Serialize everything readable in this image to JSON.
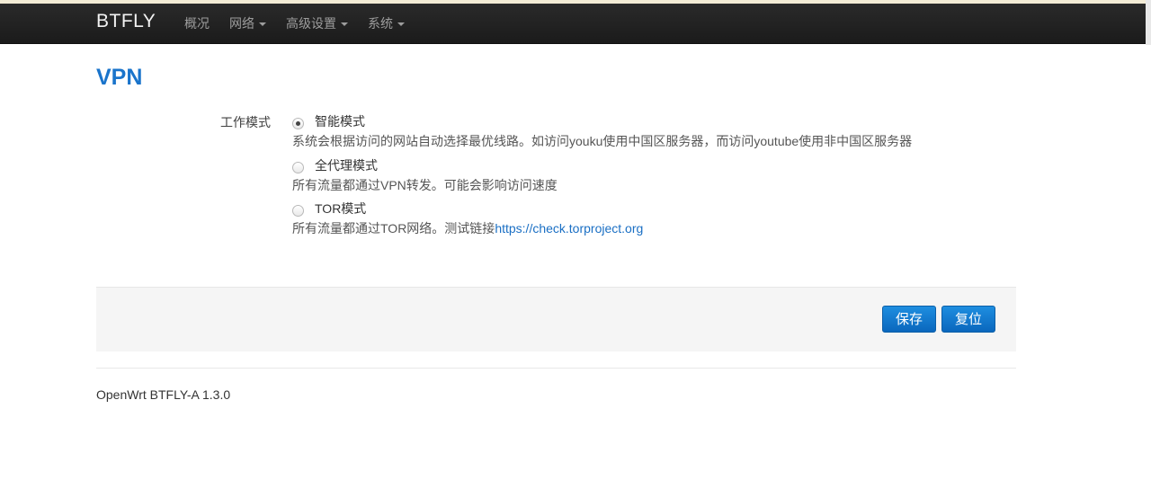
{
  "navbar": {
    "brand": "BTFLY",
    "items": [
      {
        "label": "概况",
        "dropdown": false
      },
      {
        "label": "网络",
        "dropdown": true
      },
      {
        "label": "高级设置",
        "dropdown": true
      },
      {
        "label": "系统",
        "dropdown": true
      }
    ]
  },
  "page": {
    "title": "VPN",
    "field_label": "工作模式",
    "options": [
      {
        "label": "智能模式",
        "checked": true,
        "description": "系统会根据访问的网站自动选择最优线路。如访问youku使用中国区服务器，而访问youtube使用非中国区服务器"
      },
      {
        "label": "全代理模式",
        "checked": false,
        "description": "所有流量都通过VPN转发。可能会影响访问速度"
      },
      {
        "label": "TOR模式",
        "checked": false,
        "description": "所有流量都通过TOR网络。测试链接",
        "link": "https://check.torproject.org"
      }
    ]
  },
  "actions": {
    "save_label": "保存",
    "reset_label": "复位"
  },
  "footer": {
    "text": "OpenWrt BTFLY-A 1.3.0"
  },
  "colors": {
    "navbar_bg": "#1b1b1b",
    "title": "#1a74cb",
    "button": "#0a67bd",
    "link": "#1a6fc4"
  }
}
